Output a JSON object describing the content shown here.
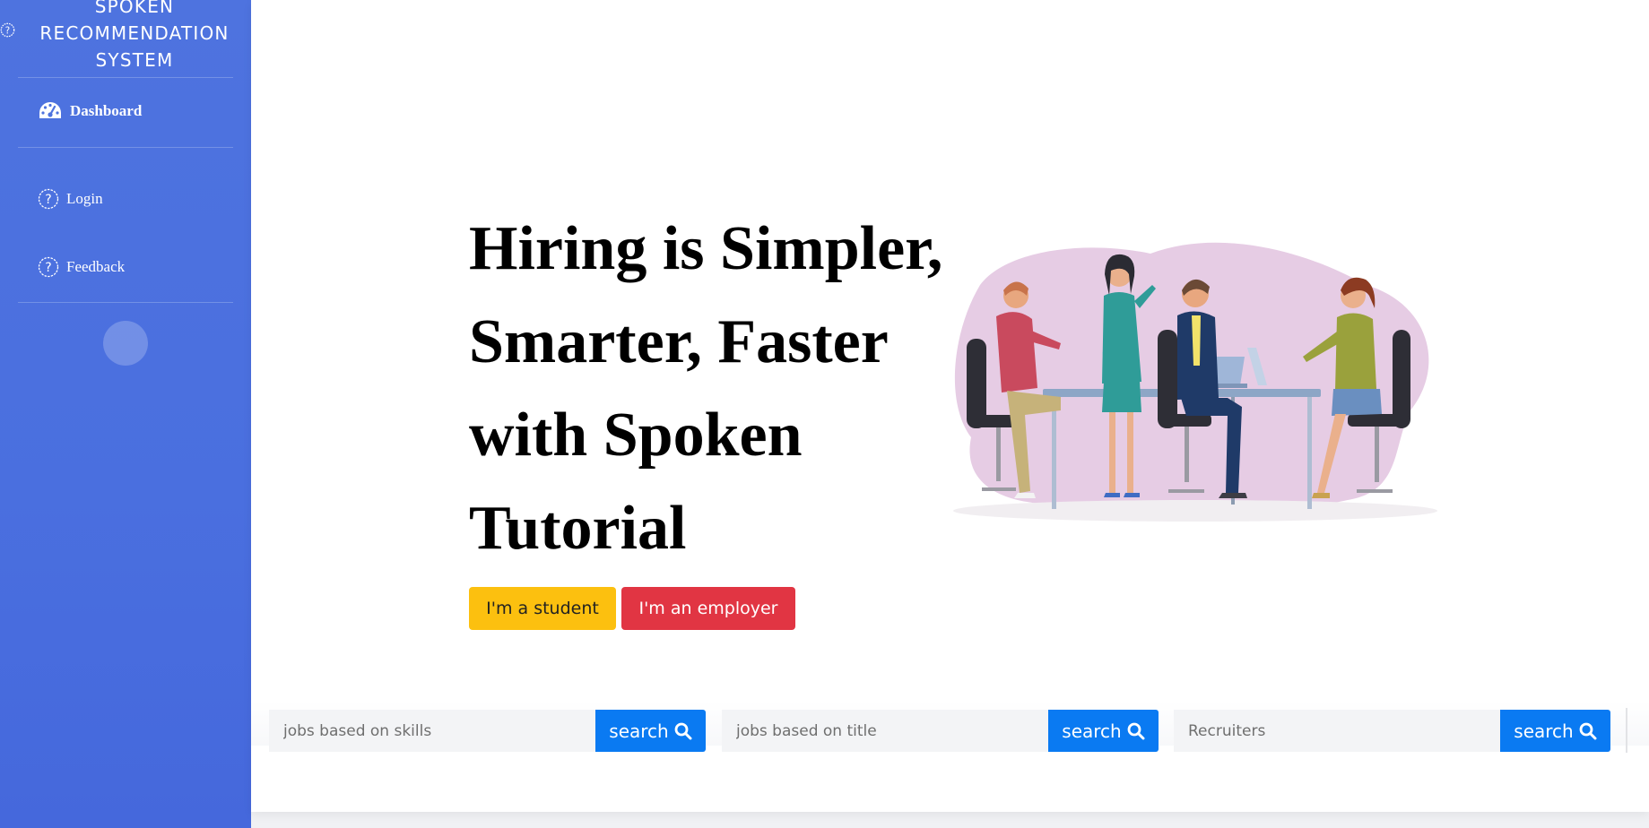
{
  "sidebar": {
    "brand_lines": [
      "SPOKEN",
      "RECOMMENDATION",
      "SYSTEM"
    ],
    "items": [
      {
        "label": "Dashboard",
        "icon": "tachometer-icon",
        "active": true
      },
      {
        "label": "Login",
        "icon": "question-circle-icon",
        "active": false
      },
      {
        "label": "Feedback",
        "icon": "question-circle-icon",
        "active": false
      }
    ]
  },
  "hero": {
    "title_lines": [
      "Hiring is Simpler,",
      "Smarter, Faster",
      "with Spoken",
      "Tutorial"
    ],
    "student_button": "I'm a student",
    "employer_button": "I'm an employer",
    "illustration": "team-meeting-illustration"
  },
  "search": [
    {
      "placeholder": "jobs based on skills",
      "button": "search",
      "icon": "search-icon"
    },
    {
      "placeholder": "jobs based on title",
      "button": "search",
      "icon": "search-icon"
    },
    {
      "placeholder": "Recruiters",
      "button": "search",
      "icon": "search-icon"
    }
  ],
  "colors": {
    "sidebar": "#4e73df",
    "student_btn": "#fcc00f",
    "employer_btn": "#e13543",
    "search_btn": "#0a7af2"
  }
}
